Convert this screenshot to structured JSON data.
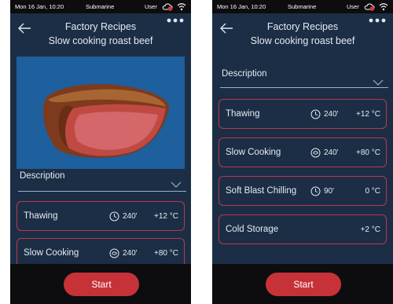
{
  "status_bar": {
    "datetime": "Mon 16 Jan, 10:20",
    "device": "Submarine",
    "user": "User",
    "cloud_icon": "cloud-alert-icon",
    "wifi_icon": "wifi-icon"
  },
  "header": {
    "title": "Factory Recipes",
    "subtitle": "Slow cooking roast beef",
    "back_icon": "back-arrow-icon",
    "more_icon": "more-dots-icon"
  },
  "hero_image": {
    "subject": "roast beef slice",
    "background": "#1e5f9d"
  },
  "description": {
    "label": "Description",
    "chevron_icon": "chevron-down-icon"
  },
  "steps": [
    {
      "name": "Thawing",
      "duration": "240'",
      "temperature": "+12 °C",
      "clock_icon": "clock-icon"
    },
    {
      "name": "Slow Cooking",
      "duration": "240'",
      "temperature": "+80 °C",
      "clock_icon": "fan-clock-icon"
    },
    {
      "name": "Soft Blast Chilling",
      "duration": "90'",
      "temperature": "0 °C",
      "clock_icon": "clock-icon"
    },
    {
      "name": "Cold Storage",
      "duration": "",
      "temperature": "+2 °C"
    }
  ],
  "start_button": {
    "label": "Start"
  },
  "colors": {
    "screen_bg": "#1c2e45",
    "bar_bg": "#0d0d0f",
    "accent_red": "#c73238",
    "card_border": "#b63a4c"
  }
}
